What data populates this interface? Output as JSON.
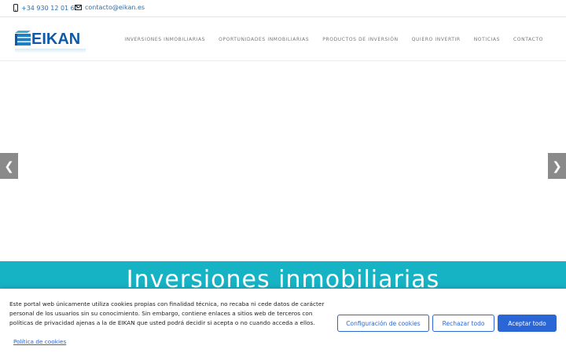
{
  "topbar": {
    "phone": "+34 930 12 01 62",
    "email": "contacto@eikan.es",
    "phone_icon": "mobile-phone-icon",
    "email_icon": "envelope-icon"
  },
  "header": {
    "logo_text": "EIKAN",
    "logo_icon": "building-stack-icon",
    "nav": [
      "INVERSIONES INMOBILIARIAS",
      "OPORTUNIDADES INMOBILIARIAS",
      "PRODUCTOS DE INVERSIÓN",
      "QUIERO INVERTIR",
      "NOTICIAS",
      "CONTACTO"
    ]
  },
  "slider": {
    "prev": "❮",
    "next": "❯"
  },
  "band": {
    "title": "Inversiones inmobiliarias"
  },
  "cookie": {
    "message": "Este portal web únicamente utiliza cookies propias con finalidad técnica, no recaba ni cede datos de carácter personal de los usuarios sin su conocimiento. Sin embargo, contiene enlaces a sitios web de terceros con políticas de privacidad ajenas a la de EIKAN que usted podrá decidir si acepta o no cuando acceda a ellos.",
    "config_label": "Configuración de cookies",
    "reject_label": "Rechazar todo",
    "accept_label": "Aceptar todo",
    "policy_label": "Política de cookies"
  },
  "colors": {
    "brand_blue": "#0f5aa8",
    "link_blue": "#2b66d6",
    "teal": "#16b3c5",
    "arrow_gray": "#8a8a8a"
  }
}
